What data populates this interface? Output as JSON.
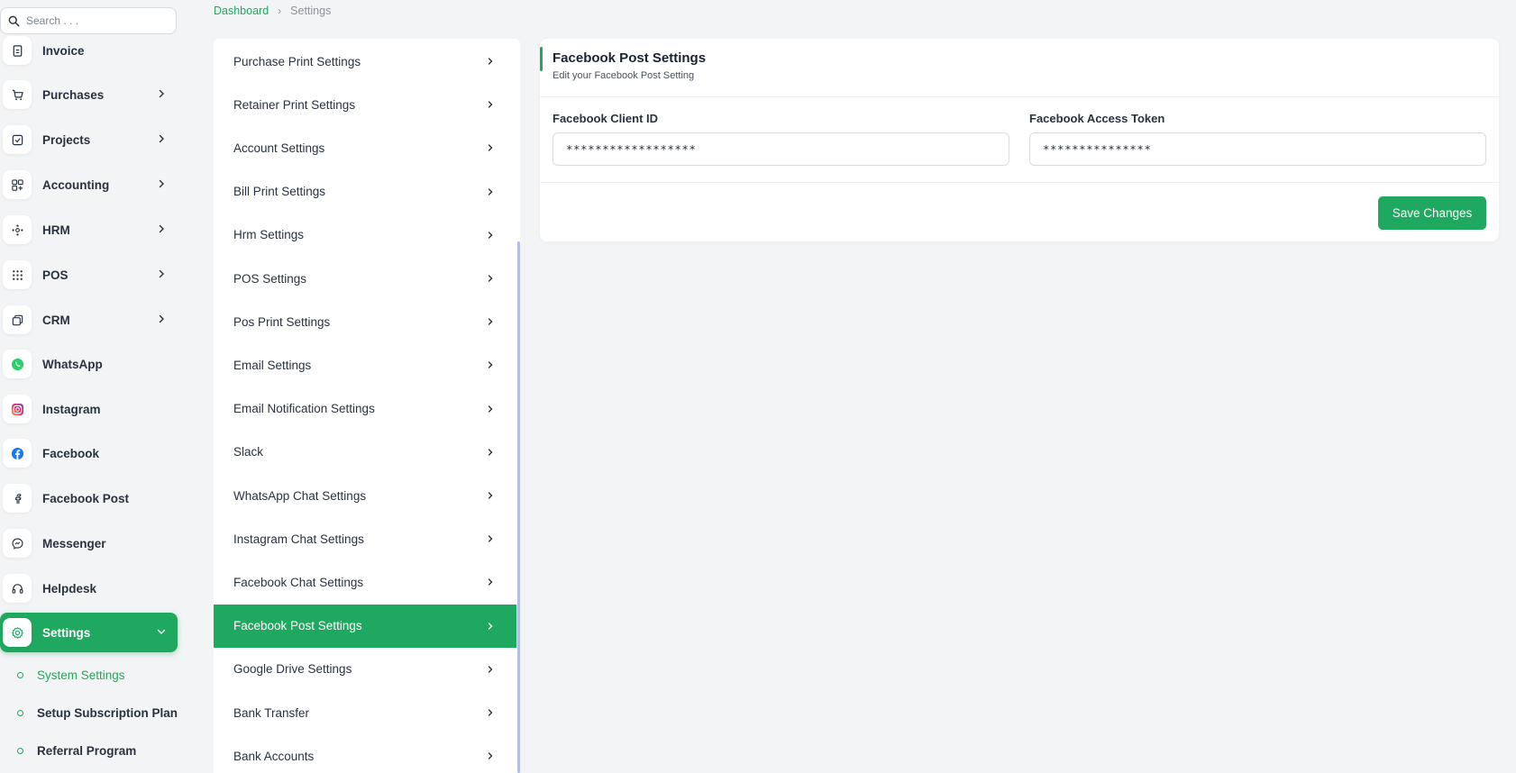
{
  "search": {
    "placeholder": "Search . . ."
  },
  "sidebar": {
    "items": [
      {
        "label": "Invoice",
        "icon": "invoice-icon"
      },
      {
        "label": "Purchases",
        "icon": "cart-icon"
      },
      {
        "label": "Projects",
        "icon": "check-square-icon"
      },
      {
        "label": "Accounting",
        "icon": "grid-plus-icon"
      },
      {
        "label": "HRM",
        "icon": "users-cluster-icon"
      },
      {
        "label": "POS",
        "icon": "dots-grid-icon"
      },
      {
        "label": "CRM",
        "icon": "layers-icon"
      },
      {
        "label": "WhatsApp",
        "icon": "whatsapp-icon"
      },
      {
        "label": "Instagram",
        "icon": "instagram-icon"
      },
      {
        "label": "Facebook",
        "icon": "facebook-icon"
      },
      {
        "label": "Facebook Post",
        "icon": "facebook-post-icon"
      },
      {
        "label": "Messenger",
        "icon": "messenger-icon"
      },
      {
        "label": "Helpdesk",
        "icon": "headset-icon"
      },
      {
        "label": "Settings",
        "icon": "gear-icon"
      }
    ],
    "sub_items": [
      {
        "label": "System Settings"
      },
      {
        "label": "Setup Subscription Plan"
      },
      {
        "label": "Referral Program"
      }
    ]
  },
  "breadcrumb": {
    "home": "Dashboard",
    "current": "Settings"
  },
  "settings_menu": [
    "Purchase Print Settings",
    "Retainer Print Settings",
    "Account Settings",
    "Bill Print Settings",
    "Hrm Settings",
    "POS Settings",
    "Pos Print Settings",
    "Email Settings",
    "Email Notification Settings",
    "Slack",
    "WhatsApp Chat Settings",
    "Instagram Chat Settings",
    "Facebook Chat Settings",
    "Facebook Post Settings",
    "Google Drive Settings",
    "Bank Transfer",
    "Bank Accounts"
  ],
  "card": {
    "title": "Facebook Post Settings",
    "subtitle": "Edit your Facebook Post Setting",
    "client_id_label": "Facebook Client ID",
    "client_id_value": "******************",
    "access_token_label": "Facebook Access Token",
    "access_token_value": "***************",
    "save_label": "Save Changes"
  },
  "colors": {
    "accent": "#1fa85f",
    "text": "#293240",
    "background": "#f3f4f5"
  }
}
